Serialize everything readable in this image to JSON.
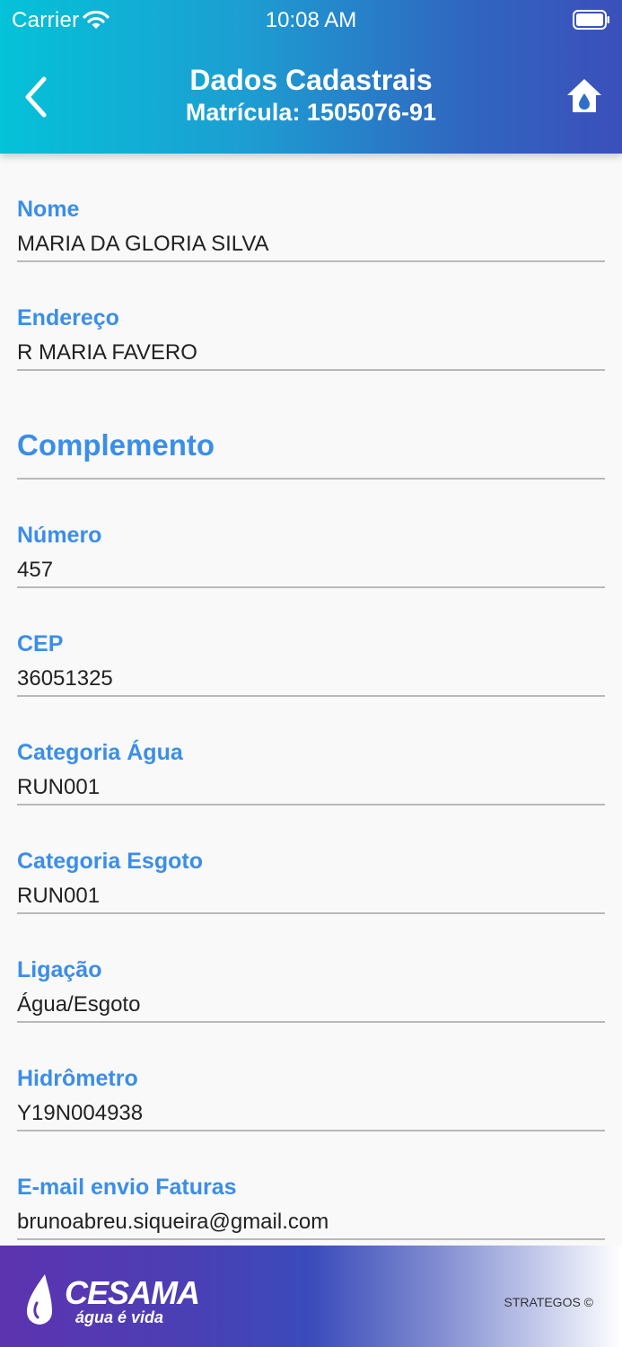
{
  "status_bar": {
    "carrier": "Carrier",
    "time": "10:08 AM",
    "icons": [
      "wifi-icon",
      "battery-icon"
    ]
  },
  "header": {
    "title": "Dados Cadastrais",
    "subtitle": "Matrícula: 1505076-91",
    "back_icon": "chevron-left-icon",
    "home_icon": "home-drop-icon"
  },
  "fields": [
    {
      "label": "Nome",
      "value": "MARIA DA GLORIA SILVA"
    },
    {
      "label": "Endereço",
      "value": "R MARIA FAVERO"
    },
    {
      "section": "Complemento"
    },
    {
      "label": "Número",
      "value": "457"
    },
    {
      "label": "CEP",
      "value": "36051325"
    },
    {
      "label": "Categoria Água",
      "value": "RUN001"
    },
    {
      "label": "Categoria Esgoto",
      "value": "RUN001"
    },
    {
      "label": "Ligação",
      "value": "Água/Esgoto"
    },
    {
      "label": "Hidrômetro",
      "value": "Y19N004938"
    },
    {
      "label": "E-mail envio Faturas",
      "value": "brunoabreu.siqueira@gmail.com"
    }
  ],
  "footer": {
    "logo_name": "CESAMA",
    "logo_tagline": "água é vida",
    "credit": "STRATEGOS ©"
  },
  "colors": {
    "label": "#3b8ee8",
    "value": "#222222",
    "divider": "#b9b9b9",
    "header_start": "#04c2d8",
    "header_end": "#3b4fbb"
  }
}
